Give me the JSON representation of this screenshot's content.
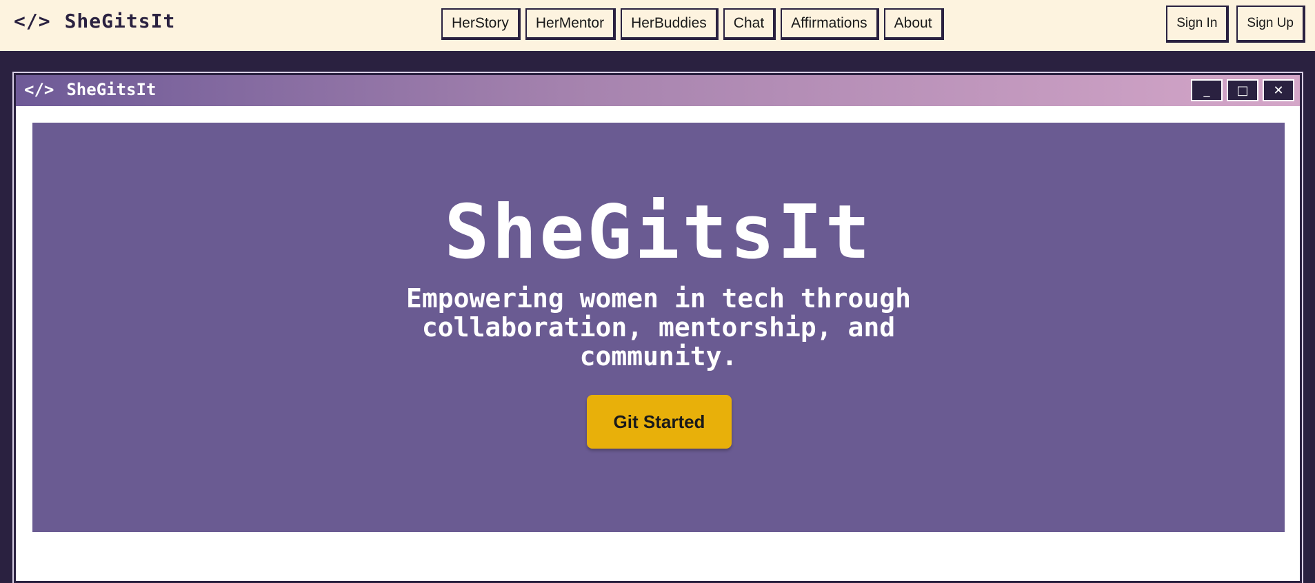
{
  "header": {
    "brand_icon": "</>",
    "brand_name": "SheGitsIt",
    "nav": [
      {
        "label": "HerStory"
      },
      {
        "label": "HerMentor"
      },
      {
        "label": "HerBuddies"
      },
      {
        "label": "Chat"
      },
      {
        "label": "Affirmations"
      },
      {
        "label": "About"
      }
    ],
    "auth": {
      "sign_in": "Sign In",
      "sign_up": "Sign Up"
    }
  },
  "window": {
    "title_icon": "</>",
    "title": "SheGitsIt",
    "controls": {
      "minimize": "_",
      "maximize": "□",
      "close": "✕"
    }
  },
  "hero": {
    "title": "SheGitsIt",
    "subtitle": "Empowering women in tech through collaboration, mentorship, and community.",
    "cta_label": "Git Started"
  },
  "colors": {
    "cream": "#fdf3df",
    "dark": "#2a2140",
    "hero_bg": "#6a5b92",
    "cta": "#e8b00a",
    "titlebar_start": "#6e5a97",
    "titlebar_end": "#d4a6c8"
  }
}
